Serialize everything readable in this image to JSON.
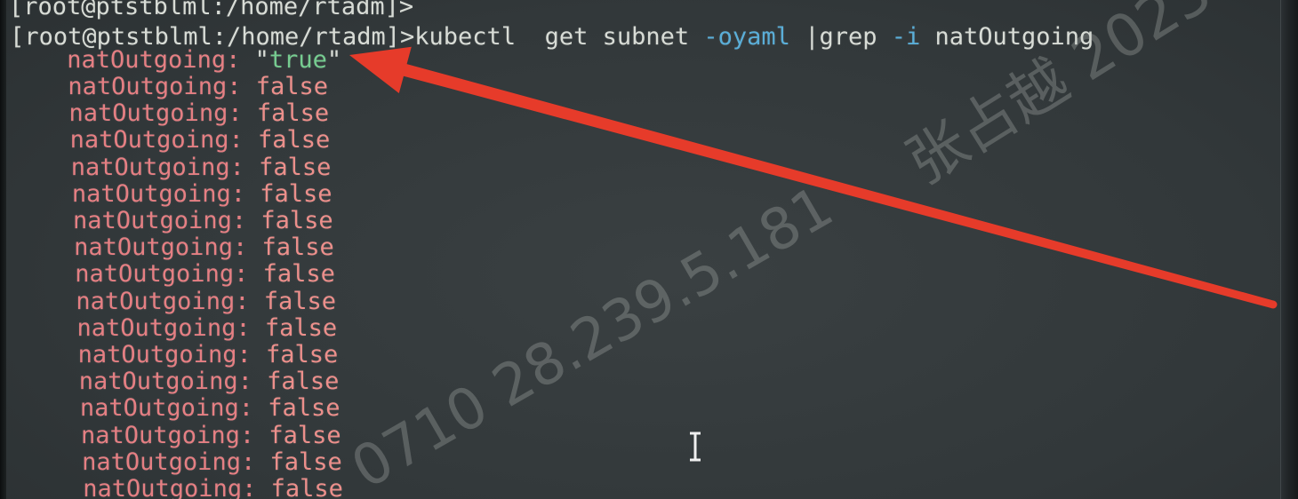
{
  "theme": {
    "background": "#32383a",
    "text": "#d8dcd6",
    "flag": "#5aaed8",
    "key": "#e57f83",
    "false_value": "#ec8f8b",
    "true_value": "#76cc90",
    "arrow": "#e63b2a",
    "watermark": "#c9cec9",
    "cursor": "#f0f0f0"
  },
  "terminal": {
    "previous_prompt": "[root@ptstblml:/home/rtadm]>",
    "command_line": {
      "prompt": "[root@ptstblml:/home/rtadm]>",
      "command": "kubectl",
      "verb": "get",
      "resource": "subnet",
      "output_flag": "-oyaml",
      "pipe_grep": "|grep",
      "ignore_case_flag": "-i",
      "pattern": "natOutgoing"
    },
    "output": [
      {
        "key": "natOutgoing:",
        "quote_open": "\"",
        "value": "true",
        "quote_close": "\""
      },
      {
        "key": "natOutgoing:",
        "value": "false"
      },
      {
        "key": "natOutgoing:",
        "value": "false"
      },
      {
        "key": "natOutgoing:",
        "value": "false"
      },
      {
        "key": "natOutgoing:",
        "value": "false"
      },
      {
        "key": "natOutgoing:",
        "value": "false"
      },
      {
        "key": "natOutgoing:",
        "value": "false"
      },
      {
        "key": "natOutgoing:",
        "value": "false"
      },
      {
        "key": "natOutgoing:",
        "value": "false"
      },
      {
        "key": "natOutgoing:",
        "value": "false"
      },
      {
        "key": "natOutgoing:",
        "value": "false"
      },
      {
        "key": "natOutgoing:",
        "value": "false"
      },
      {
        "key": "natOutgoing:",
        "value": "false"
      },
      {
        "key": "natOutgoing:",
        "value": "false"
      },
      {
        "key": "natOutgoing:",
        "value": "false"
      },
      {
        "key": "natOutgoing:",
        "value": "false"
      },
      {
        "key": "natOutgoing:",
        "value": "false"
      }
    ]
  },
  "watermark": {
    "top": "张占越 2023",
    "bottom": "0710 28.239.5.181"
  },
  "icons": {
    "annotation": "red-arrow",
    "mouse_cursor": "text-cursor-icon"
  }
}
